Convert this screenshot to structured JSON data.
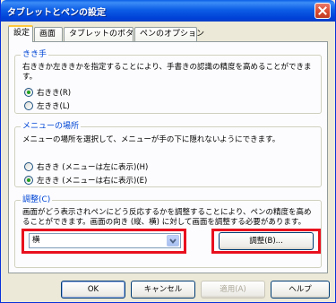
{
  "window": {
    "title": "タブレットとペンの設定"
  },
  "tabs": [
    {
      "label": "設定",
      "active": true
    },
    {
      "label": "画面",
      "active": false
    },
    {
      "label": "タブレットのボタン",
      "active": false
    },
    {
      "label": "ペンのオプション",
      "active": false
    }
  ],
  "handedness": {
    "title": "きき手",
    "description": "右ききか左ききかを指定することにより、手書きの認識の精度を高めることができます。",
    "options": [
      {
        "label": "右きき(R)",
        "checked": true
      },
      {
        "label": "左きき(L)",
        "checked": false
      }
    ]
  },
  "menu_location": {
    "title": "メニューの場所",
    "description": "メニューの場所を選択して、メニューが手の下に隠れないようにできます。",
    "options": [
      {
        "label": "右きき (メニューは左に表示)(H)",
        "checked": false
      },
      {
        "label": "左きき (メニューは右に表示)(E)",
        "checked": true
      }
    ]
  },
  "calibration": {
    "title": "調整(C)",
    "description": "画面がどう表示されペンにどう反応するかを調整することにより、ペンの精度を高めることができます。画面の向き (縦、横) に対して画面を調整する必要があります。",
    "orientation_value": "横",
    "calibrate_button": "調整(B)..."
  },
  "footer": {
    "ok": "OK",
    "cancel": "キャンセル",
    "apply": "適用(A)",
    "help": "ヘルプ"
  },
  "colors": {
    "title_bar": "#0a5ee6",
    "group_title": "#0046d5",
    "highlight_frame": "#e8101e",
    "radio_checked": "#21a121"
  },
  "icons": {
    "close": "close-icon",
    "dropdown": "chevron-down-icon"
  }
}
